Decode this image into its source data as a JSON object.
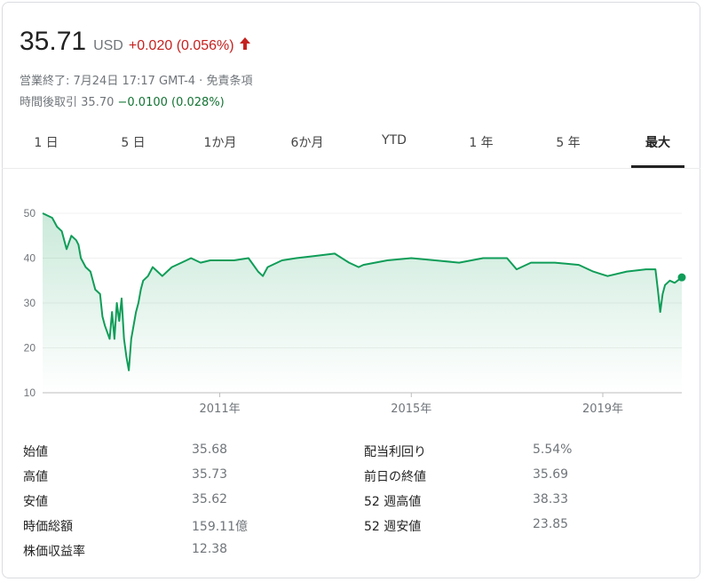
{
  "quote": {
    "price": "35.71",
    "currency": "USD",
    "change": "+0.020 (0.056%)",
    "market_status": "営業終了: 7月24日 17:17 GMT-4 · 免責条項",
    "after_hours_label": "時間後取引",
    "after_hours_price": "35.70",
    "after_hours_change": "−0.0100 (0.028%)"
  },
  "tabs": [
    "1 日",
    "5 日",
    "1か月",
    "6か月",
    "YTD",
    "1 年",
    "5 年",
    "最大"
  ],
  "active_tab": "最大",
  "colors": {
    "line": "#0f9d58",
    "positive": "#137333",
    "negative": "#c5221f"
  },
  "chart_data": {
    "type": "area",
    "ylim": [
      10,
      50
    ],
    "yticks": [
      "10",
      "20",
      "30",
      "40",
      "50"
    ],
    "xtick_labels": [
      {
        "year": 2011,
        "label": "2011年"
      },
      {
        "year": 2015,
        "label": "2015年"
      },
      {
        "year": 2019,
        "label": "2019年"
      }
    ],
    "xlim": [
      2007.3,
      2020.65
    ],
    "grid": true,
    "series": [
      {
        "x": [
          2007.3,
          2007.5,
          2007.6,
          2007.7,
          2007.8,
          2007.9,
          2008.0,
          2008.05,
          2008.1,
          2008.2,
          2008.3,
          2008.4,
          2008.5,
          2008.55,
          2008.6,
          2008.7,
          2008.75,
          2008.8,
          2008.85,
          2008.9,
          2008.95,
          2009.0,
          2009.05,
          2009.1,
          2009.15,
          2009.2,
          2009.25,
          2009.3,
          2009.35,
          2009.4,
          2009.5,
          2009.6,
          2009.7,
          2009.8,
          2009.9,
          2010.0,
          2010.2,
          2010.4,
          2010.6,
          2010.8,
          2011.0,
          2011.3,
          2011.6,
          2011.8,
          2011.9,
          2012.0,
          2012.3,
          2012.6,
          2013.0,
          2013.4,
          2013.7,
          2013.9,
          2014.0,
          2014.5,
          2015.0,
          2015.5,
          2016.0,
          2016.5,
          2017.0,
          2017.2,
          2017.5,
          2018.0,
          2018.5,
          2018.8,
          2018.95,
          2019.1,
          2019.5,
          2019.9,
          2020.1,
          2020.15,
          2020.2,
          2020.25,
          2020.3,
          2020.4,
          2020.5,
          2020.65
        ],
        "y": [
          50,
          49,
          47,
          46,
          42,
          45,
          44,
          43,
          40,
          38,
          37,
          33,
          32,
          27,
          25,
          22,
          28,
          22,
          30,
          26,
          31,
          22,
          18,
          15,
          22,
          25,
          28,
          30,
          33,
          35,
          36,
          38,
          37,
          36,
          37,
          38,
          39,
          40,
          39,
          39.5,
          39.5,
          39.5,
          40,
          37,
          36,
          38,
          39.5,
          40,
          40.5,
          41,
          39,
          38,
          38.5,
          39.5,
          40,
          39.5,
          39,
          40,
          40,
          37.5,
          39,
          39,
          38.5,
          37,
          36.5,
          36,
          37,
          37.5,
          37.5,
          33,
          28,
          32,
          34,
          35,
          34.5,
          35.71
        ]
      }
    ]
  }
}
